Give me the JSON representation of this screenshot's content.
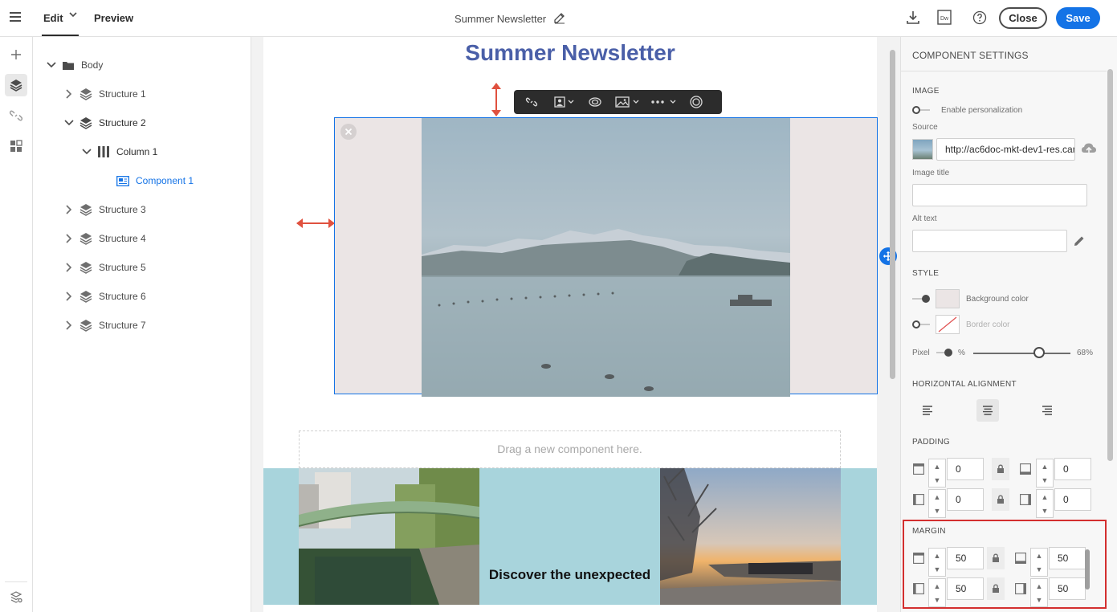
{
  "topbar": {
    "tabs": [
      {
        "label": "Edit"
      },
      {
        "label": "Preview"
      }
    ],
    "document_title": "Summer Newsletter",
    "close_label": "Close",
    "save_label": "Save",
    "dw_label": "Dw"
  },
  "tree": {
    "items": [
      {
        "label": "Body"
      },
      {
        "label": "Structure 1"
      },
      {
        "label": "Structure 2"
      },
      {
        "label": "Column 1"
      },
      {
        "label": "Component 1"
      },
      {
        "label": "Structure 3"
      },
      {
        "label": "Structure 4"
      },
      {
        "label": "Structure 5"
      },
      {
        "label": "Structure 6"
      },
      {
        "label": "Structure 7"
      }
    ]
  },
  "canvas": {
    "newsletter_title": "Summer Newsletter",
    "drop_zone_text": "Drag a new component here.",
    "structure_text": "Discover the unexpected"
  },
  "panel": {
    "title": "COMPONENT SETTINGS",
    "image": {
      "section_label": "IMAGE",
      "enable_personalization_label": "Enable personalization",
      "source_label": "Source",
      "source_value": "http://ac6doc-mkt-dev1-res.campaign",
      "image_title_label": "Image title",
      "image_title_value": "",
      "alt_text_label": "Alt text",
      "alt_text_value": ""
    },
    "style": {
      "section_label": "STYLE",
      "background_color_label": "Background color",
      "border_color_label": "Border color",
      "background_color": "#ebe5e5",
      "pixel_label": "Pixel",
      "percent_label": "%",
      "opacity_value_label": "68%",
      "opacity_value": 0.68
    },
    "alignment": {
      "section_label": "HORIZONTAL ALIGNMENT",
      "selected": "center"
    },
    "padding": {
      "section_label": "PADDING",
      "top": "0",
      "bottom": "0",
      "left": "0",
      "right": "0"
    },
    "margin": {
      "section_label": "MARGIN",
      "top": "50",
      "bottom": "50",
      "left": "50",
      "right": "50"
    }
  },
  "colors": {
    "accent": "#1473e6",
    "title_blue": "#4a5fa8",
    "highlight_red": "#d32f2f",
    "structure_bg": "#a8d4dc"
  }
}
